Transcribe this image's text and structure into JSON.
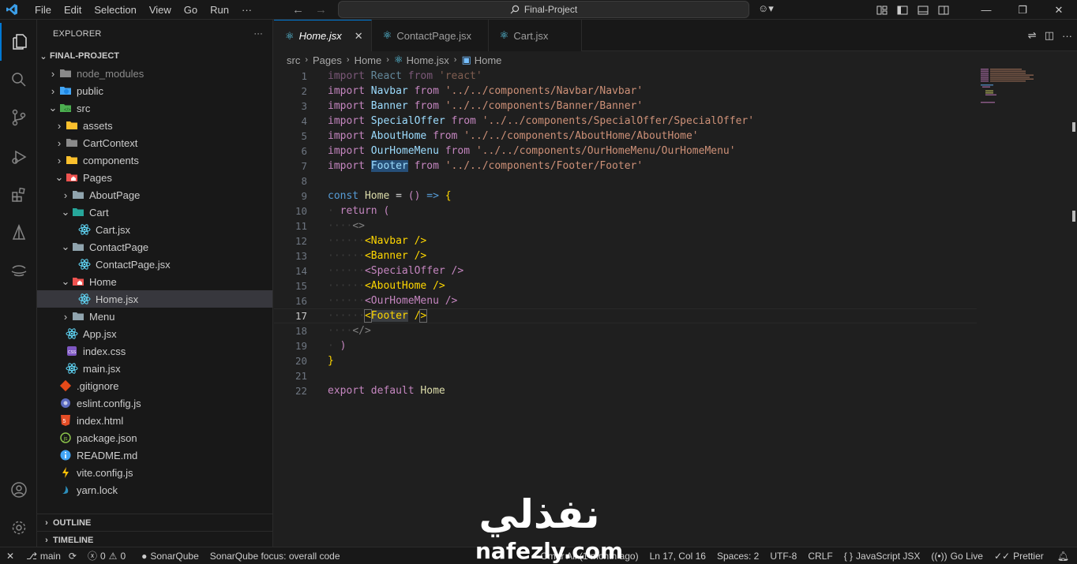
{
  "menu": [
    "File",
    "Edit",
    "Selection",
    "View",
    "Go",
    "Run",
    "···"
  ],
  "command_center": {
    "label": "Final-Project"
  },
  "sidebar": {
    "title": "EXPLORER",
    "more": "···",
    "root": "FINAL-PROJECT",
    "items": [
      {
        "label": "node_modules",
        "kind": "folder"
      },
      {
        "label": "public",
        "kind": "folder"
      },
      {
        "label": "src",
        "kind": "folder"
      },
      {
        "label": "assets",
        "kind": "folder"
      },
      {
        "label": "CartContext",
        "kind": "folder"
      },
      {
        "label": "components",
        "kind": "folder"
      },
      {
        "label": "Pages",
        "kind": "folder"
      },
      {
        "label": "AboutPage",
        "kind": "folder"
      },
      {
        "label": "Cart",
        "kind": "folder"
      },
      {
        "label": "Cart.jsx",
        "kind": "file"
      },
      {
        "label": "ContactPage",
        "kind": "folder"
      },
      {
        "label": "ContactPage.jsx",
        "kind": "file"
      },
      {
        "label": "Home",
        "kind": "folder"
      },
      {
        "label": "Home.jsx",
        "kind": "file"
      },
      {
        "label": "Menu",
        "kind": "folder"
      },
      {
        "label": "App.jsx",
        "kind": "file"
      },
      {
        "label": "index.css",
        "kind": "file"
      },
      {
        "label": "main.jsx",
        "kind": "file"
      },
      {
        "label": ".gitignore",
        "kind": "file"
      },
      {
        "label": "eslint.config.js",
        "kind": "file"
      },
      {
        "label": "index.html",
        "kind": "file"
      },
      {
        "label": "package.json",
        "kind": "file"
      },
      {
        "label": "README.md",
        "kind": "file"
      },
      {
        "label": "vite.config.js",
        "kind": "file"
      },
      {
        "label": "yarn.lock",
        "kind": "file"
      }
    ],
    "outline": "OUTLINE",
    "timeline": "TIMELINE"
  },
  "tabs": [
    {
      "label": "Home.jsx",
      "active": true,
      "close": "✕"
    },
    {
      "label": "ContactPage.jsx",
      "active": false
    },
    {
      "label": "Cart.jsx",
      "active": false
    }
  ],
  "breadcrumb": [
    "src",
    "Pages",
    "Home",
    "Home.jsx",
    "Home"
  ],
  "line_numbers": [
    "1",
    "2",
    "3",
    "4",
    "5",
    "6",
    "7",
    "8",
    "9",
    "10",
    "11",
    "12",
    "13",
    "14",
    "15",
    "16",
    "17",
    "18",
    "19",
    "20",
    "21",
    "22"
  ],
  "current_line": "17",
  "code": {
    "kw_import": "import",
    "kw_from": "from",
    "kw_const": "const",
    "kw_return": "return",
    "kw_export": "export",
    "kw_default": "default",
    "react": "React",
    "react_src": "'react'",
    "navbar": "Navbar",
    "navbar_src": "'../../components/Navbar/Navbar'",
    "banner": "Banner",
    "banner_src": "'../../components/Banner/Banner'",
    "special": "SpecialOffer",
    "special_src": "'../../components/SpecialOffer/SpecialOffer'",
    "about": "AboutHome",
    "about_src": "'../../components/AboutHome/AboutHome'",
    "menu": "OurHomeMenu",
    "menu_src": "'../../components/OurHomeMenu/OurHomeMenu'",
    "footer": "Footer",
    "footer_src": "'../../components/Footer/Footer'",
    "home": "Home"
  },
  "status": {
    "branch": "main",
    "errors": "0",
    "warnings": "0",
    "sonar": "SonarQube",
    "sonar_focus": "SonarQube focus: overall code",
    "blame": "Omar Ali (1 month ago)",
    "position": "Ln 17, Col 16",
    "spaces": "Spaces: 2",
    "encoding": "UTF-8",
    "eol": "CRLF",
    "language": "JavaScript JSX",
    "golive": "Go Live",
    "prettier": "Prettier"
  },
  "watermark": {
    "arabic": "نفذلي",
    "latin": "nafezly.com"
  },
  "colors": {
    "accent": "#0078d4",
    "folder": "#dcb67a",
    "react": "#61dafb"
  }
}
